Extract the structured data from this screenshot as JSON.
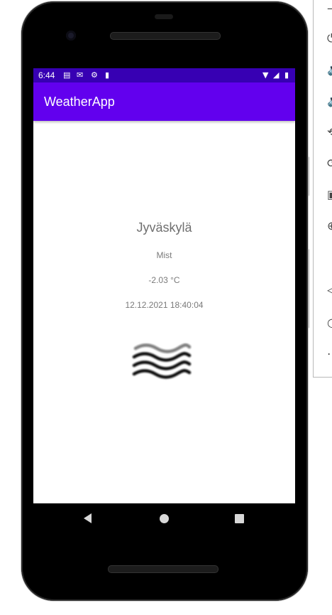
{
  "status_bar": {
    "time": "6:44",
    "left_icons": [
      "calendar-icon",
      "gmail-icon",
      "settings-icon",
      "sd-card-icon"
    ],
    "right_icons": [
      "wifi-icon",
      "signal-icon",
      "battery-icon"
    ]
  },
  "app_bar": {
    "title": "WeatherApp",
    "color": "#6200ee",
    "status_color": "#3700b3"
  },
  "weather": {
    "city": "Jyväskylä",
    "condition": "Mist",
    "temperature": "-2.03 °C",
    "timestamp": "12.12.2021 18:40:04",
    "icon": "mist-icon"
  },
  "nav_bar": {
    "buttons": [
      "back-icon",
      "home-icon",
      "recents-icon"
    ]
  }
}
